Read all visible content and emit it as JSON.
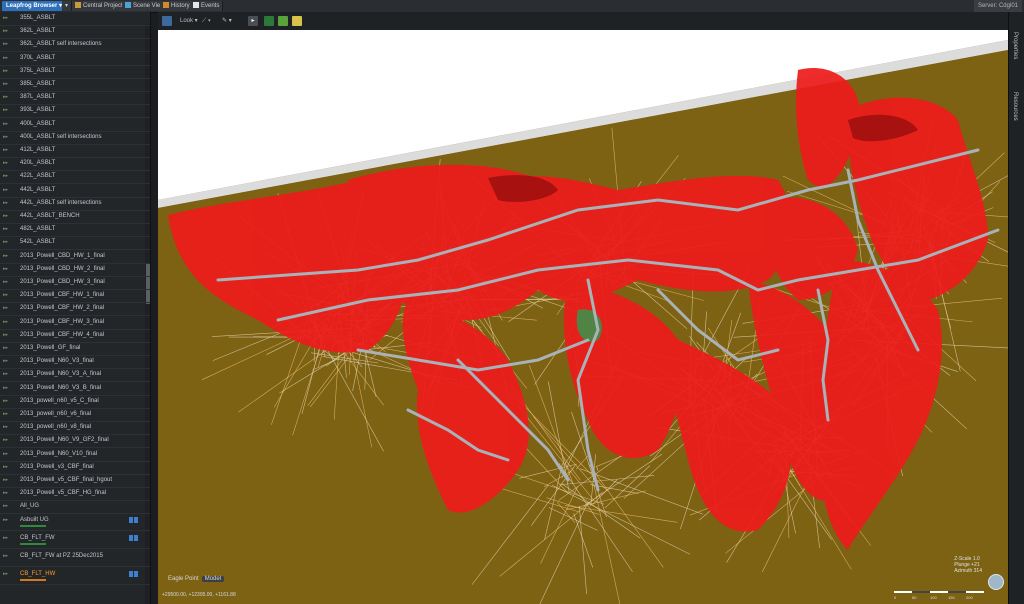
{
  "app": {
    "title": "Leapfrog Browser"
  },
  "tabs": [
    {
      "label": "Central Projects",
      "icon": "central-projects-icon"
    },
    {
      "label": "Scene View",
      "icon": "scene-view-icon"
    },
    {
      "label": "History",
      "icon": "history-icon"
    },
    {
      "label": "Events",
      "icon": "events-icon"
    }
  ],
  "server": {
    "label": "Server: Cdgl01"
  },
  "toolbar": {
    "look_label": "Look"
  },
  "sidebar": {
    "items": [
      {
        "label": "355L_ASBLT"
      },
      {
        "label": "362L_ASBLT"
      },
      {
        "label": "362L_ASBLT self intersections"
      },
      {
        "label": "370L_ASBLT"
      },
      {
        "label": "375L_ASBLT"
      },
      {
        "label": "385L_ASBLT"
      },
      {
        "label": "387L_ASBLT"
      },
      {
        "label": "393L_ASBLT"
      },
      {
        "label": "400L_ASBLT"
      },
      {
        "label": "400L_ASBLT self intersections"
      },
      {
        "label": "412L_ASBLT"
      },
      {
        "label": "420L_ASBLT"
      },
      {
        "label": "422L_ASBLT"
      },
      {
        "label": "442L_ASBLT"
      },
      {
        "label": "442L_ASBLT self intersections"
      },
      {
        "label": "442L_ASBLT_BENCH"
      },
      {
        "label": "482L_ASBLT"
      },
      {
        "label": "542L_ASBLT"
      },
      {
        "label": "2013_Powell_CBD_HW_1_final"
      },
      {
        "label": "2013_Powell_CBD_HW_2_final"
      },
      {
        "label": "2013_Powell_CBD_HW_3_final"
      },
      {
        "label": "2013_Powell_CBF_HW_1_final"
      },
      {
        "label": "2013_Powell_CBF_HW_2_final"
      },
      {
        "label": "2013_Powell_CBF_HW_3_final"
      },
      {
        "label": "2013_Powell_CBF_HW_4_final"
      },
      {
        "label": "2013_Powell_GF_final"
      },
      {
        "label": "2013_Powell_N60_V3_final"
      },
      {
        "label": "2013_Powell_N60_V3_A_final"
      },
      {
        "label": "2013_Powell_N60_V3_B_final"
      },
      {
        "label": "2013_powell_n60_v5_C_final"
      },
      {
        "label": "2013_powell_n60_v6_final"
      },
      {
        "label": "2013_powell_n60_v8_final"
      },
      {
        "label": "2013_Powell_N60_V9_GF2_final"
      },
      {
        "label": "2013_Powell_N60_V10_final"
      },
      {
        "label": "2013_Powell_v3_CBF_final"
      },
      {
        "label": "2013_Powell_v5_CBF_final_hgout"
      },
      {
        "label": "2013_Powell_v5_CBF_HG_final"
      },
      {
        "label": "All_UG"
      }
    ],
    "special": [
      {
        "label": "Asbuilt UG"
      },
      {
        "label": "CB_FLT_FW"
      },
      {
        "label": "CB_FLT_FW at PZ 25Dec2015"
      },
      {
        "label": "CB_FLT_HW"
      }
    ]
  },
  "rightpanel": {
    "label1": "Properties",
    "label2": "Resources"
  },
  "viewport": {
    "eagle_label": "Eagle Point",
    "model_label": "Model",
    "coords": "+29500.00, +12395.00, +1161.88",
    "zscale": "Z-Scale 1.0",
    "plunge": "Plunge +21",
    "azimuth": "Azimuth 314",
    "scale_ticks": [
      "0",
      "50",
      "100",
      "150",
      "200"
    ]
  }
}
